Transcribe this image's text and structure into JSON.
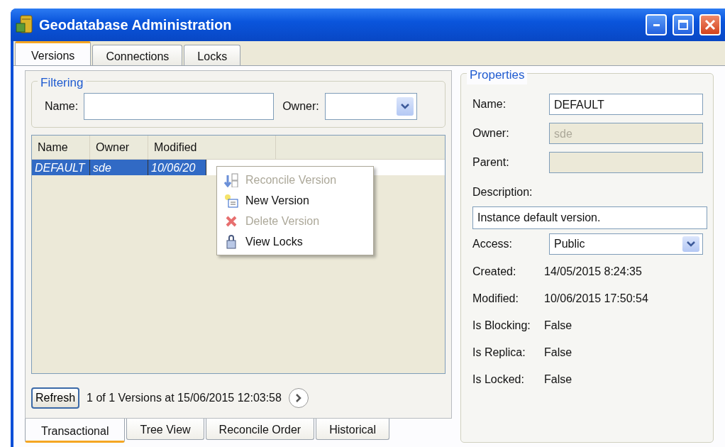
{
  "window": {
    "title": "Geodatabase Administration"
  },
  "tabs": [
    {
      "label": "Versions",
      "selected": true
    },
    {
      "label": "Connections",
      "selected": false
    },
    {
      "label": "Locks",
      "selected": false
    }
  ],
  "filtering": {
    "title": "Filtering",
    "name_label": "Name:",
    "owner_label": "Owner:"
  },
  "table": {
    "columns": [
      "Name",
      "Owner",
      "Modified"
    ],
    "rows": [
      {
        "cells": [
          "DEFAULT",
          "sde",
          "10/06/20"
        ],
        "selected": true
      }
    ]
  },
  "context_menu": [
    {
      "label": "Reconcile Version",
      "disabled": true,
      "kind": "reconcile"
    },
    {
      "label": "New Version",
      "disabled": false,
      "kind": "new"
    },
    {
      "label": "Delete Version",
      "disabled": true,
      "kind": "delete"
    },
    {
      "label": "View Locks",
      "disabled": false,
      "kind": "locks"
    }
  ],
  "footer": {
    "refresh_button": "Refresh",
    "status": "1 of 1 Versions at 15/06/2015 12:03:58"
  },
  "subtabs": [
    {
      "label": "Transactional",
      "selected": true
    },
    {
      "label": "Tree View",
      "selected": false
    },
    {
      "label": "Reconcile Order",
      "selected": false
    },
    {
      "label": "Historical",
      "selected": false
    }
  ],
  "properties": {
    "title": "Properties",
    "rows": [
      {
        "kind": "input",
        "label": "Name:",
        "value": "DEFAULT"
      },
      {
        "kind": "readonly",
        "label": "Owner:",
        "value": "sde"
      },
      {
        "kind": "readonly",
        "label": "Parent:"
      },
      {
        "kind": "stacked",
        "label": "Description:",
        "value": "Instance default version."
      },
      {
        "kind": "combo",
        "label": "Access:",
        "value": "Public"
      },
      {
        "kind": "value",
        "label": "Created:",
        "value": "14/05/2015 8:24:35"
      },
      {
        "kind": "value",
        "label": "Modified:",
        "value": "10/06/2015 17:50:54"
      },
      {
        "kind": "value",
        "label": "Is Blocking:",
        "value": "False"
      },
      {
        "kind": "value",
        "label": "Is Replica:",
        "value": "False"
      },
      {
        "kind": "value",
        "label": "Is Locked:",
        "value": "False"
      }
    ]
  }
}
